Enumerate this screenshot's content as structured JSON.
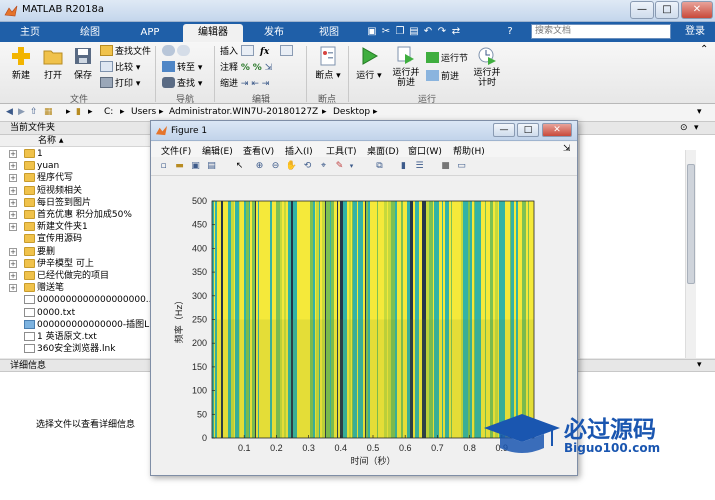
{
  "app": {
    "title": "MATLAB R2018a",
    "window_controls": [
      "—",
      "□",
      "✕"
    ]
  },
  "ribbon_tabs": [
    {
      "label": "主页",
      "active": false
    },
    {
      "label": "绘图",
      "active": false
    },
    {
      "label": "APP",
      "active": false
    },
    {
      "label": "编辑器",
      "active": true
    },
    {
      "label": "发布",
      "active": false
    },
    {
      "label": "视图",
      "active": false
    }
  ],
  "search": {
    "placeholder": "搜索文档"
  },
  "login_label": "登录",
  "ribbon": {
    "file_group": {
      "label": "文件",
      "new": "新建",
      "open": "打开",
      "save": "保存",
      "find_files": "查找文件",
      "compare": "比较",
      "print": "打印"
    },
    "nav_group": {
      "label": "导航",
      "goto": "转至",
      "find": "查找"
    },
    "edit_group": {
      "label": "编辑",
      "insert": "插入",
      "comment": "注释",
      "indent": "缩进",
      "fx": "fx"
    },
    "breakpoints_group": {
      "label": "断点",
      "breakpoints": "断点"
    },
    "run_group": {
      "label": "运行",
      "run": "运行",
      "run_and_advance": "运行并\n前进",
      "run_section": "运行节",
      "advance": "前进",
      "run_and_time": "运行并\n计时"
    }
  },
  "address": {
    "path": [
      "C:",
      "Users",
      "Administrator.WIN7U-20180127Z",
      "Desktop"
    ]
  },
  "current_folder": {
    "header": "当前文件夹",
    "column_name": "名称",
    "sort_indicator": "▲",
    "items": [
      {
        "name": "1",
        "type": "folder",
        "expandable": true
      },
      {
        "name": "yuan",
        "type": "folder",
        "expandable": true
      },
      {
        "name": "程序代写",
        "type": "folder",
        "expandable": true
      },
      {
        "name": "短视频相关",
        "type": "folder",
        "expandable": true
      },
      {
        "name": "每日签到图片",
        "type": "folder",
        "expandable": true
      },
      {
        "name": "首充优惠 积分加成50%",
        "type": "folder",
        "expandable": true
      },
      {
        "name": "新建文件夹1",
        "type": "folder",
        "expandable": true
      },
      {
        "name": "宣传用源码",
        "type": "folder",
        "expandable": false
      },
      {
        "name": "要删",
        "type": "folder",
        "expandable": true
      },
      {
        "name": "伊辛模型 可上",
        "type": "folder",
        "expandable": true
      },
      {
        "name": "已经代做完的项目",
        "type": "folder",
        "expandable": true
      },
      {
        "name": "赠送笔",
        "type": "folder",
        "expandable": true
      },
      {
        "name": "0000000000000000000...",
        "type": "file",
        "expandable": false
      },
      {
        "name": "0000.txt",
        "type": "file",
        "expandable": false
      },
      {
        "name": "000000000000000-插图L...",
        "type": "img",
        "expandable": false
      },
      {
        "name": "1 英语原文.txt",
        "type": "file",
        "expandable": false
      },
      {
        "name": "360安全浏览器.lnk",
        "type": "file",
        "expandable": false
      }
    ]
  },
  "details": {
    "header": "详细信息",
    "message": "选择文件以查看详细信息"
  },
  "figure": {
    "title": "Figure 1",
    "menu": [
      "文件(F)",
      "编辑(E)",
      "查看(V)",
      "插入(I)",
      "工具(T)",
      "桌面(D)",
      "窗口(W)",
      "帮助(H)"
    ],
    "tools": [
      "new-icon",
      "open-icon",
      "save-icon",
      "print-icon",
      "pointer-icon",
      "zoom-in-icon",
      "zoom-out-icon",
      "pan-icon",
      "rotate-icon",
      "datacursor-icon",
      "brush-icon",
      "link-icon",
      "colorbar-icon",
      "legend-icon",
      "hide-icon",
      "dock-icon"
    ]
  },
  "chart_data": {
    "type": "heatmap",
    "xlabel": "时间（秒）",
    "ylabel": "频率（Hz）",
    "xlim": [
      0,
      1
    ],
    "ylim": [
      0,
      500
    ],
    "xticks": [
      0.1,
      0.2,
      0.3,
      0.4,
      0.5,
      0.6,
      0.7,
      0.8,
      0.9
    ],
    "yticks": [
      0,
      50,
      100,
      150,
      200,
      250,
      300,
      350,
      400,
      450,
      500
    ],
    "colors": {
      "yellow": "#f5e93a",
      "teal": "#33b3a6",
      "green": "#7dc153",
      "dark": "#26374a",
      "lime": "#c6d93c"
    },
    "description_note": "spectrogram of vertical color bands across full frequency range"
  },
  "watermark": {
    "cn": "必过源码",
    "en": "Biguo100.com"
  }
}
